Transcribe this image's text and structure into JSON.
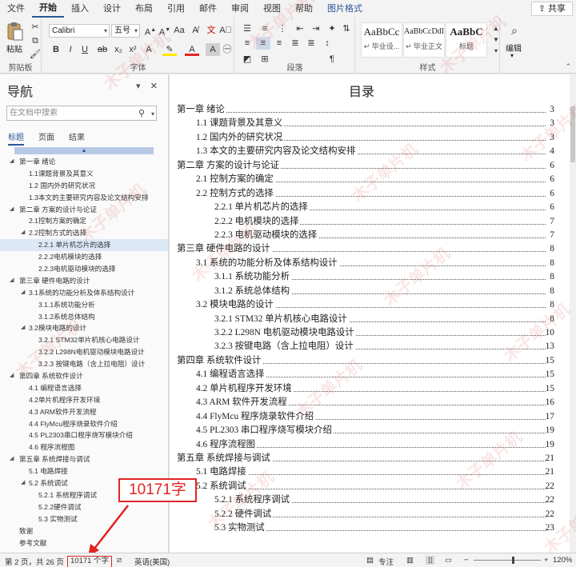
{
  "ribbon": {
    "tabs": [
      "文件",
      "开始",
      "插入",
      "设计",
      "布局",
      "引用",
      "邮件",
      "审阅",
      "视图",
      "帮助",
      "图片格式"
    ],
    "share": "共享",
    "clipboard": {
      "paste": "粘贴",
      "label": "剪贴板"
    },
    "font": {
      "name": "Calibri",
      "size": "五号",
      "label": "字体"
    },
    "paragraph": {
      "label": "段落"
    },
    "styles": {
      "label": "样式",
      "items": [
        {
          "sample": "AaBbCc",
          "name": "↵ 毕业设..."
        },
        {
          "sample": "AaBbCcDdI",
          "name": "↵ 毕业正文"
        },
        {
          "sample": "AaBbC",
          "name": "标题"
        }
      ]
    },
    "editing": {
      "label": "编辑"
    }
  },
  "nav": {
    "title": "导航",
    "search_placeholder": "在文档中搜索",
    "tabs": [
      "标题",
      "页面",
      "结果"
    ],
    "items": [
      {
        "level": 1,
        "text": "第一章 绪论"
      },
      {
        "level": 2,
        "text": "1.1课题背景及其意义"
      },
      {
        "level": 2,
        "text": "1.2 国内外的研究状况"
      },
      {
        "level": 2,
        "text": "1.3本文的主要研究内容及论文结构安排"
      },
      {
        "level": 1,
        "text": "第二章 方案的设计与论证"
      },
      {
        "level": 2,
        "text": "2.1控制方案的确定"
      },
      {
        "level": 2,
        "text": "2.2控制方式的选择"
      },
      {
        "level": 3,
        "text": "2.2.1 单片机芯片的选择"
      },
      {
        "level": 3,
        "text": "2.2.2电机模块的选择"
      },
      {
        "level": 3,
        "text": "2.2.3电机驱动模块的选择"
      },
      {
        "level": 1,
        "text": "第三章 硬件电路的设计"
      },
      {
        "level": 2,
        "text": "3.1系统的功能分析及体系结构设计"
      },
      {
        "level": 3,
        "text": "3.1.1系统功能分析"
      },
      {
        "level": 3,
        "text": "3.1.2系统总体结构"
      },
      {
        "level": 2,
        "text": "3.2模块电路的设计"
      },
      {
        "level": 3,
        "text": "3.2.1 STM32单片机核心电路设计"
      },
      {
        "level": 3,
        "text": "3.2.2 L298N电机驱动模块电路设计"
      },
      {
        "level": 3,
        "text": "3.2.3 按键电路（含上拉电阻）设计"
      },
      {
        "level": 1,
        "text": "第四章 系统软件设计"
      },
      {
        "level": 2,
        "text": "4.1 编程语言选择"
      },
      {
        "level": 2,
        "text": "4.2单片机程序开发环境"
      },
      {
        "level": 2,
        "text": "4.3 ARM软件开发流程"
      },
      {
        "level": 2,
        "text": "4.4 FlyMcu程序烧录软件介绍"
      },
      {
        "level": 2,
        "text": "4.5 PL2303串口程序烧写模块介绍"
      },
      {
        "level": 2,
        "text": "4.6 程序流程图"
      },
      {
        "level": 1,
        "text": "第五章 系统焊接与调试"
      },
      {
        "level": 2,
        "text": "5.1 电路焊接"
      },
      {
        "level": 2,
        "text": "5.2 系统调试"
      },
      {
        "level": 3,
        "text": "5.2.1 系统程序调试"
      },
      {
        "level": 3,
        "text": "5.2.2硬件调试"
      },
      {
        "level": 3,
        "text": "5.3 实物测试"
      },
      {
        "level": 0,
        "text": "致谢"
      },
      {
        "level": 0,
        "text": "参考文献"
      }
    ]
  },
  "doc": {
    "toc_title": "目录",
    "toc": [
      {
        "level": 1,
        "text": "第一章  绪论",
        "page": "3"
      },
      {
        "level": 2,
        "text": "1.1 课题背景及其意义",
        "page": "3"
      },
      {
        "level": 2,
        "text": "1.2 国内外的研究状况",
        "page": "3"
      },
      {
        "level": 2,
        "text": "1.3 本文的主要研究内容及论文结构安排",
        "page": "4"
      },
      {
        "level": 1,
        "text": "第二章  方案的设计与论证",
        "page": "6"
      },
      {
        "level": 2,
        "text": "2.1 控制方案的确定",
        "page": "6"
      },
      {
        "level": 2,
        "text": "2.2 控制方式的选择",
        "page": "6"
      },
      {
        "level": 3,
        "text": "2.2.1  单片机芯片的选择",
        "page": "6"
      },
      {
        "level": 3,
        "text": "2.2.2 电机模块的选择",
        "page": "7"
      },
      {
        "level": 3,
        "text": "2.2.3 电机驱动模块的选择",
        "page": "7"
      },
      {
        "level": 1,
        "text": "第三章  硬件电路的设计",
        "page": "8"
      },
      {
        "level": 2,
        "text": "3.1 系统的功能分析及体系结构设计",
        "page": "8"
      },
      {
        "level": 3,
        "text": "3.1.1 系统功能分析",
        "page": "8"
      },
      {
        "level": 3,
        "text": "3.1.2 系统总体结构",
        "page": "8"
      },
      {
        "level": 2,
        "text": "3.2 模块电路的设计",
        "page": "8"
      },
      {
        "level": 3,
        "text": "3.2.1 STM32 单片机核心电路设计",
        "page": "8"
      },
      {
        "level": 3,
        "text": "3.2.2 L298N 电机驱动模块电路设计",
        "page": "10"
      },
      {
        "level": 3,
        "text": "3.2.3  按键电路（含上拉电阻）设计",
        "page": "13"
      },
      {
        "level": 1,
        "text": "第四章  系统软件设计",
        "page": "15"
      },
      {
        "level": 2,
        "text": "4.1  编程语言选择",
        "page": "15"
      },
      {
        "level": 2,
        "text": "4.2 单片机程序开发环境",
        "page": "15"
      },
      {
        "level": 2,
        "text": "4.3 ARM 软件开发流程",
        "page": "16"
      },
      {
        "level": 2,
        "text": "4.4 FlyMcu 程序烧录软件介绍",
        "page": "17"
      },
      {
        "level": 2,
        "text": "4.5 PL2303 串口程序烧写模块介绍",
        "page": "19"
      },
      {
        "level": 2,
        "text": "4.6  程序流程图",
        "page": "19"
      },
      {
        "level": 1,
        "text": "第五章  系统焊接与调试",
        "page": "21"
      },
      {
        "level": 2,
        "text": "5.1  电路焊接",
        "page": "21"
      },
      {
        "level": 2,
        "text": "5.2  系统调试",
        "page": "22"
      },
      {
        "level": 3,
        "text": "5.2.1  系统程序调试",
        "page": "22"
      },
      {
        "level": 3,
        "text": "5.2.2  硬件调试",
        "page": "22"
      },
      {
        "level": 3,
        "text": "5.3  实物测试",
        "page": "23"
      }
    ]
  },
  "annotation": {
    "text": "10171字"
  },
  "status": {
    "page": "第 2 页，共 26 页",
    "words": "10171 个字",
    "language": "英语(美国)",
    "focus": "专注",
    "zoom": "120%"
  },
  "watermark": "木子单片机",
  "colors": {
    "accent": "#2b579a",
    "annotation": "#e02424"
  }
}
